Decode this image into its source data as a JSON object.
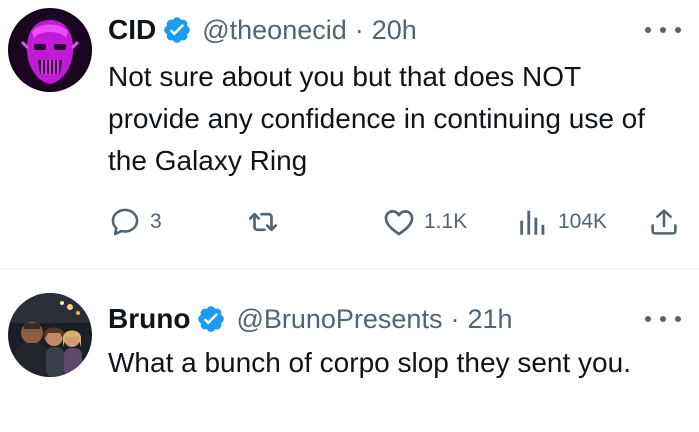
{
  "tweets": [
    {
      "display_name": "CID",
      "handle": "@theonecid",
      "separator": "·",
      "time": "20h",
      "text": "Not sure about you but that does NOT provide any confidence in continuing use of the Galaxy Ring",
      "actions": {
        "replies": "3",
        "reposts": "",
        "likes": "1.1K",
        "views": "104K"
      },
      "avatar_icon": "purple-face-avatar"
    },
    {
      "display_name": "Bruno",
      "handle": "@BrunoPresents",
      "separator": "·",
      "time": "21h",
      "text": "What a bunch of corpo slop they sent you.",
      "avatar_icon": "group-photo-avatar"
    }
  ],
  "colors": {
    "verified_blue": "#1d9bf0",
    "text_primary": "#0f1419",
    "text_secondary": "#536471",
    "divider": "#eff3f4"
  },
  "icons": {
    "more": "more-dots-icon",
    "reply": "reply-icon",
    "repost": "repost-icon",
    "like": "heart-icon",
    "views": "views-chart-icon",
    "share": "share-icon",
    "verified": "verified-badge-icon"
  }
}
